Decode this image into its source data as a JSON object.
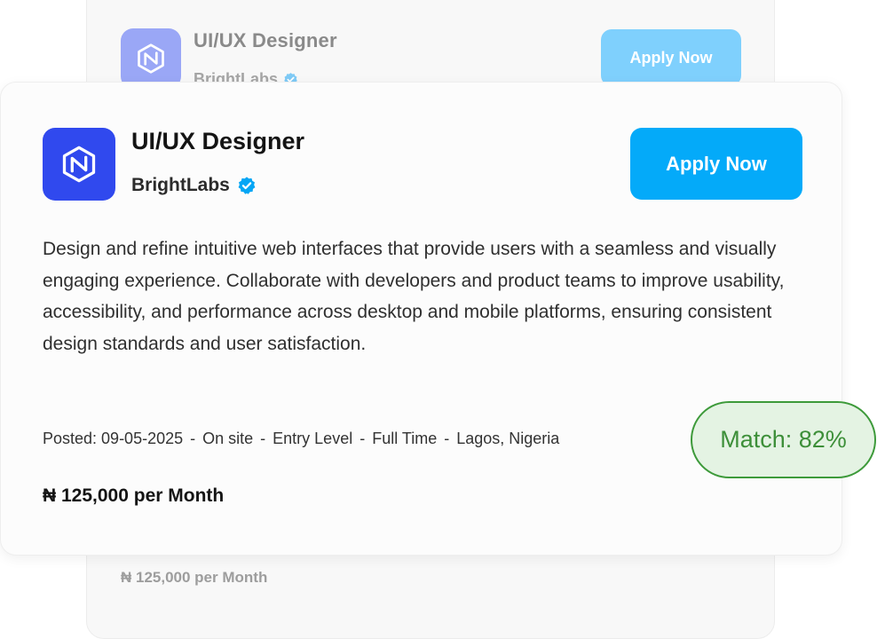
{
  "background_card": {
    "job_title": "UI/UX Designer",
    "company": "BrightLabs",
    "apply_label": "Apply Now",
    "salary": "₦ 125,000 per Month"
  },
  "job": {
    "title": "UI/UX Designer",
    "company": "BrightLabs",
    "apply_label": "Apply Now",
    "description": "Design and refine intuitive web interfaces that provide users with a seamless and visually engaging experience. Collaborate with developers and product teams to improve usability, accessibility, and performance across desktop and mobile platforms, ensuring consistent design standards and user satisfaction.",
    "meta": {
      "posted": "Posted: 09-05-2025",
      "separator": "-",
      "work_mode": "On site",
      "level": "Entry Level",
      "type": "Full Time",
      "location": "Lagos, Nigeria"
    },
    "salary": "₦ 125,000 per Month",
    "match": "Match: 82%"
  },
  "icons": {
    "logo": "brightlabs-logo-icon",
    "verified": "verified-badge-icon"
  },
  "colors": {
    "logo_bg": "#3049ee",
    "apply_bg": "#04aaf9",
    "verified": "#05a6f5",
    "match_border": "#3d9a3a",
    "match_bg": "#e4f3e3"
  }
}
